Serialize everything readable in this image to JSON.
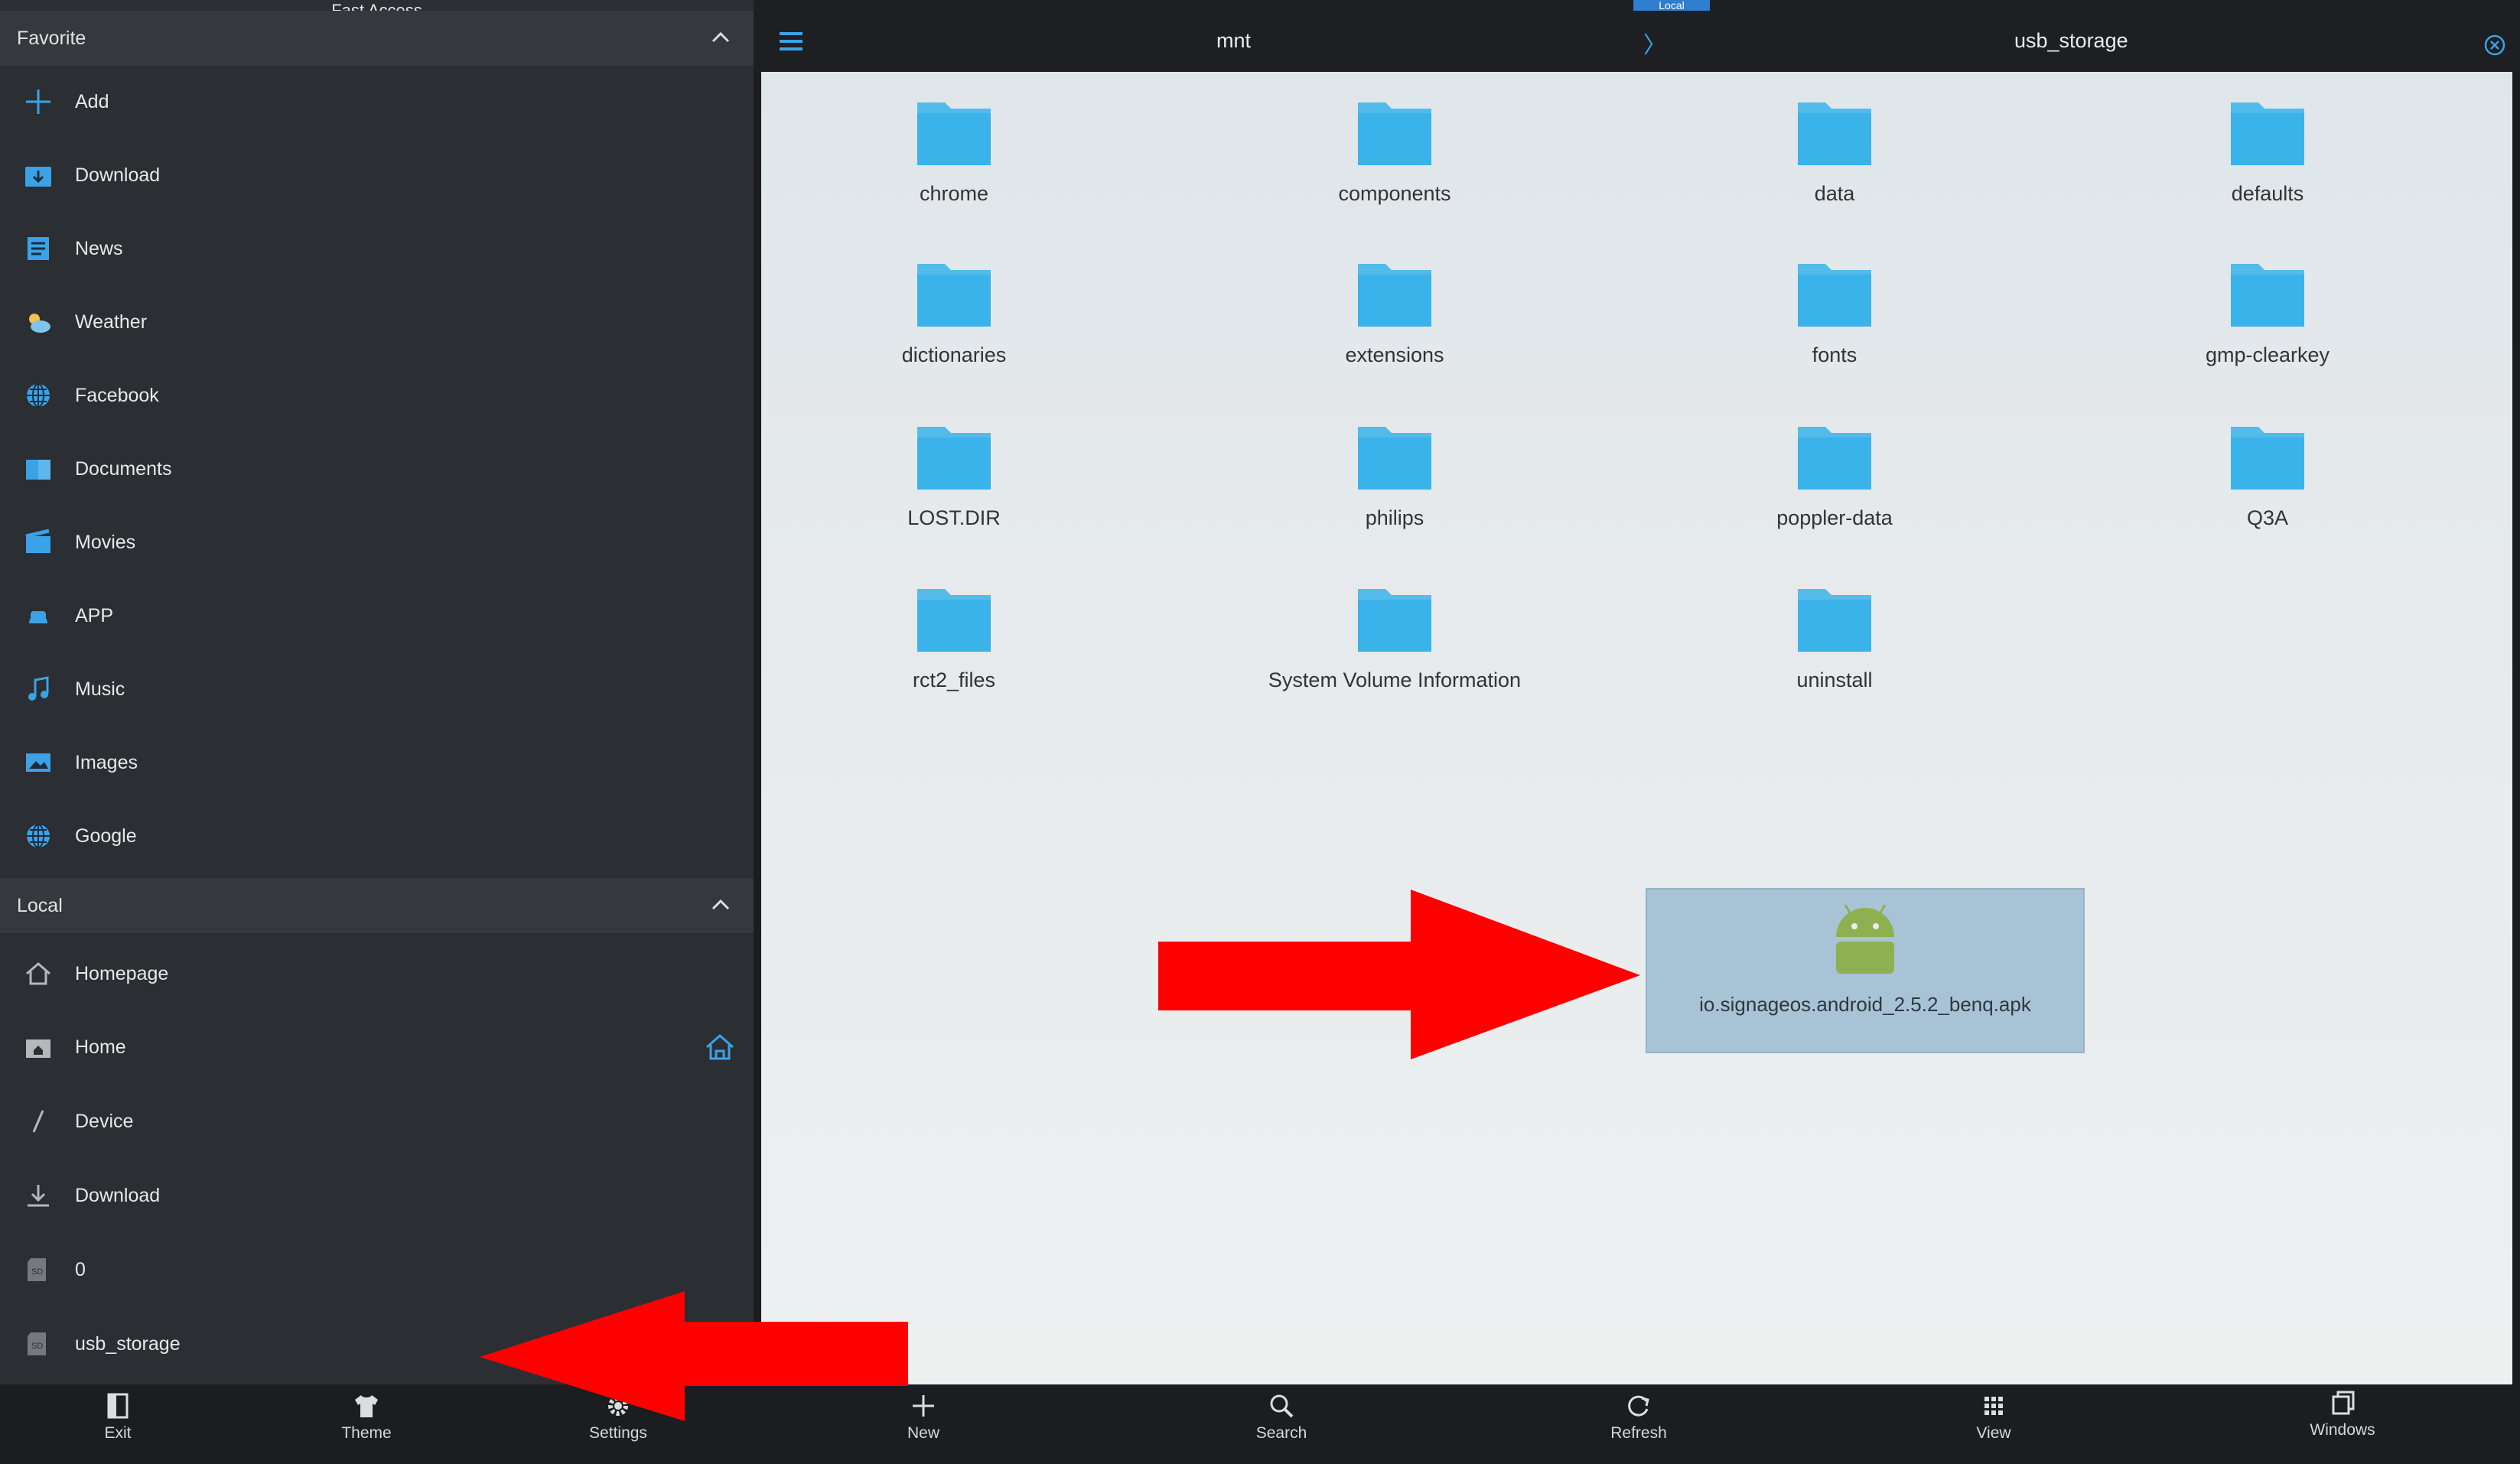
{
  "drawer": {
    "top_title": "Fast Access",
    "favorite_header": "Favorite",
    "favorite_items": [
      {
        "label": "Add",
        "icon": "plus-icon"
      },
      {
        "label": "Download",
        "icon": "download-folder-icon"
      },
      {
        "label": "News",
        "icon": "news-icon"
      },
      {
        "label": "Weather",
        "icon": "weather-icon"
      },
      {
        "label": "Facebook",
        "icon": "globe-icon"
      },
      {
        "label": "Documents",
        "icon": "documents-icon"
      },
      {
        "label": "Movies",
        "icon": "movie-icon"
      },
      {
        "label": "APP",
        "icon": "app-icon"
      },
      {
        "label": "Music",
        "icon": "music-icon"
      },
      {
        "label": "Images",
        "icon": "image-icon"
      },
      {
        "label": "Google",
        "icon": "globe-icon"
      }
    ],
    "local_header": "Local",
    "local_items": [
      {
        "label": "Homepage",
        "icon": "homepage-icon"
      },
      {
        "label": "Home",
        "icon": "home-folder-icon"
      },
      {
        "label": "Device",
        "icon": "device-slash-icon"
      },
      {
        "label": "Download",
        "icon": "download-arrow-icon"
      },
      {
        "label": "0",
        "icon": "sd-card-icon"
      },
      {
        "label": "usb_storage",
        "icon": "sd-card-icon"
      }
    ]
  },
  "pathbar": {
    "local_tag": "Local",
    "crumbs": [
      "mnt",
      "usb_storage"
    ],
    "separator": "〉"
  },
  "folders": [
    "chrome",
    "components",
    "data",
    "defaults",
    "dictionaries",
    "extensions",
    "fonts",
    "gmp-clearkey",
    "LOST.DIR",
    "philips",
    "poppler-data",
    "Q3A",
    "rct2_files",
    "System Volume Information",
    "uninstall"
  ],
  "apk_file": {
    "name": "io.signageos.android_2.5.2_benq.apk",
    "icon": "android-icon",
    "selected": true
  },
  "toolbar": {
    "exit": "Exit",
    "theme": "Theme",
    "settings": "Settings",
    "new": "New",
    "search": "Search",
    "refresh": "Refresh",
    "view": "View",
    "windows": "Windows"
  },
  "colors": {
    "accent": "#3aa3e8",
    "folder_blue": "#3ab3ea",
    "annotation_red": "#ff0000",
    "selection": "#a8c3d6"
  }
}
